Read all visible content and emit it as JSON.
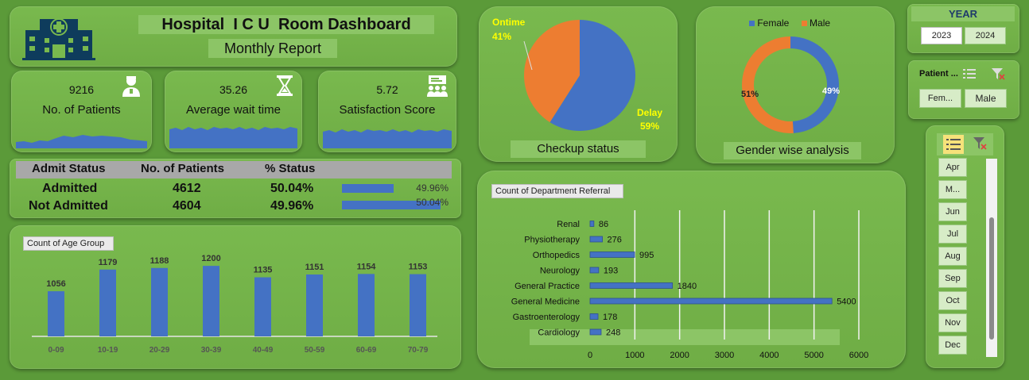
{
  "header": {
    "title": "Hospital  I C U  Room Dashboard",
    "subtitle": "Monthly Report",
    "logo_icon": "hospital-building-icon"
  },
  "kpis": [
    {
      "value": "9216",
      "label": "No. of Patients",
      "icon": "doctor-icon"
    },
    {
      "value": "35.26",
      "label": "Average wait time",
      "icon": "hourglass-icon"
    },
    {
      "value": "5.72",
      "label": "Satisfaction Score",
      "icon": "presentation-group-icon"
    }
  ],
  "admit_table": {
    "headers": [
      "Admit Status",
      "No. of Patients",
      "% Status"
    ],
    "rows": [
      {
        "status": "Admitted",
        "count": "4612",
        "pct": "50.04%",
        "bar_label": "49.96%",
        "bar_fraction": 0.5004
      },
      {
        "status": "Not Admitted",
        "count": "4604",
        "pct": "49.96%",
        "bar_label": "50.04%",
        "bar_fraction": 0.4996
      }
    ]
  },
  "checkup": {
    "title": "Checkup status",
    "chart_data": {
      "type": "pie",
      "slices": [
        {
          "label": "Ontime",
          "pct_label": "41%",
          "value": 41,
          "color": "#ed7d31"
        },
        {
          "label": "Delay",
          "pct_label": "59%",
          "value": 59,
          "color": "#4472c4"
        }
      ]
    }
  },
  "gender": {
    "title": "Gender wise analysis",
    "legend": [
      {
        "label": "Female",
        "color": "#4472c4"
      },
      {
        "label": "Male",
        "color": "#ed7d31"
      }
    ],
    "chart_data": {
      "type": "pie",
      "slices": [
        {
          "label": "Female",
          "pct_label": "49%",
          "value": 49,
          "color": "#4472c4"
        },
        {
          "label": "Male",
          "pct_label": "51%",
          "value": 51,
          "color": "#ed7d31"
        }
      ]
    }
  },
  "age_chart": {
    "title": "Count of Age Group",
    "chart_data": {
      "type": "bar",
      "categories": [
        "0-09",
        "10-19",
        "20-29",
        "30-39",
        "40-49",
        "50-59",
        "60-69",
        "70-79"
      ],
      "values": [
        1056,
        1179,
        1188,
        1200,
        1135,
        1151,
        1154,
        1153
      ],
      "ylim": [
        800,
        1250
      ],
      "color": "#4472c4"
    }
  },
  "dept_chart": {
    "title": "Count of Department Referral",
    "chart_data": {
      "type": "bar",
      "categories": [
        "Renal",
        "Physiotherapy",
        "Orthopedics",
        "Neurology",
        "General Practice",
        "General Medicine",
        "Gastroenterology",
        "Cardiology"
      ],
      "values": [
        86,
        276,
        995,
        193,
        1840,
        5400,
        178,
        248
      ],
      "xticks": [
        "0",
        "1000",
        "2000",
        "3000",
        "4000",
        "5000",
        "6000"
      ],
      "xlim": [
        0,
        6000
      ],
      "color": "#4472c4"
    }
  },
  "year_slicer": {
    "title": "YEAR",
    "options": [
      "2023",
      "2024"
    ]
  },
  "patient_slicer": {
    "title": "Patient ...",
    "options": [
      "Fem...",
      "Male"
    ]
  },
  "month_slicer": {
    "options": [
      "Apr",
      "M...",
      "Jun",
      "Jul",
      "Aug",
      "Sep",
      "Oct",
      "Nov",
      "Dec"
    ]
  }
}
